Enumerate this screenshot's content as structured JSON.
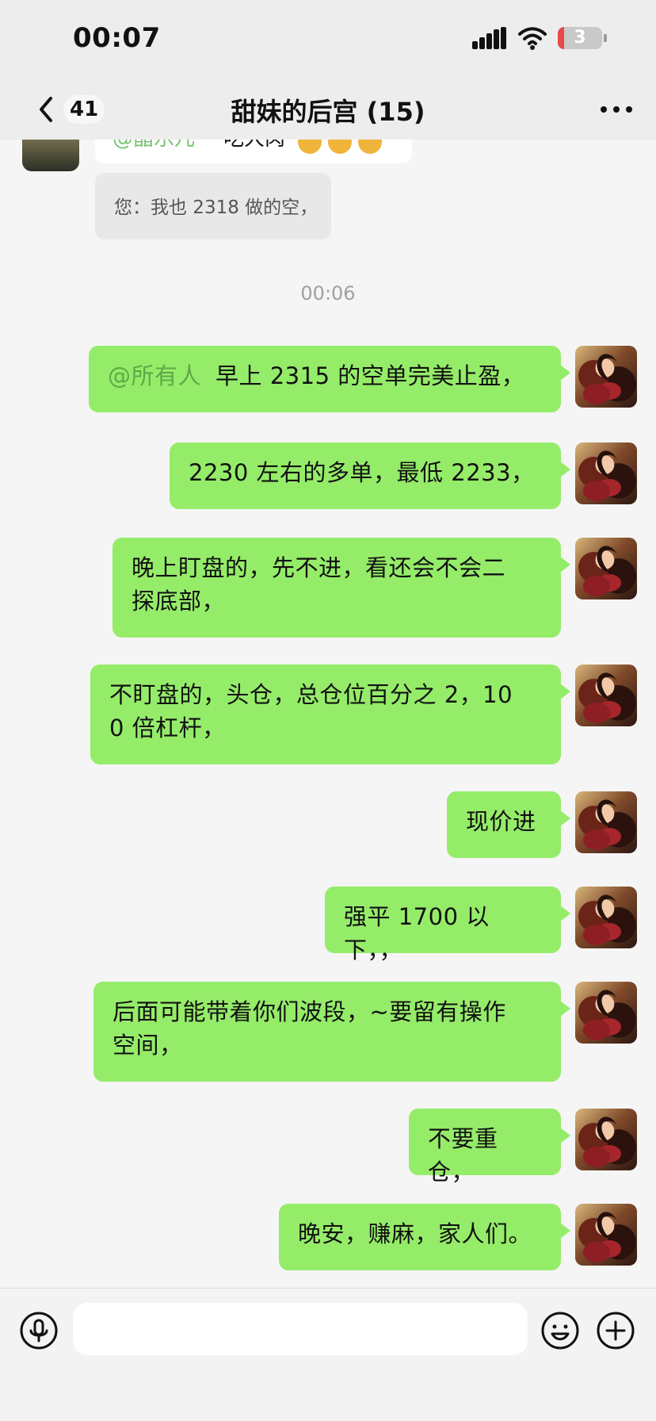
{
  "status_bar": {
    "time": "00:07",
    "battery_level": "3"
  },
  "header": {
    "back_count": "41",
    "title": "甜妹的后宫 (15)"
  },
  "chat": {
    "previous_message": {
      "mention": "@晶乐儿",
      "text": "吃大肉",
      "emoji_count": 3
    },
    "quote": "您：我也 2318 做的空，",
    "timestamp": "00:06",
    "messages": [
      {
        "mention": "@所有人",
        "text": "早上 2315 的空单完美止盈，"
      },
      {
        "text": "2230 左右的多单，最低 2233，"
      },
      {
        "line1": "晚上盯盘的，先不进，看还会不会二",
        "line2": "探底部，"
      },
      {
        "line1": "不盯盘的，头仓，总仓位百分之 2，10",
        "line2": "0 倍杠杆，"
      },
      {
        "text": "现价进"
      },
      {
        "text": "强平 1700 以下，，"
      },
      {
        "line1": "后面可能带着你们波段，~要留有操作",
        "line2": "空间，"
      },
      {
        "text": "不要重仓，"
      },
      {
        "text": "晚安，赚麻，家人们。"
      }
    ]
  },
  "input_bar": {
    "value": ""
  },
  "colors": {
    "outgoing_bubble": "#95ec69",
    "mention": "#5fa848",
    "background": "#f5f5f5"
  },
  "icons": {
    "back": "chevron-left-icon",
    "more": "more-icon",
    "voice": "microphone-icon",
    "emoji": "emoji-icon",
    "plus": "plus-icon"
  }
}
